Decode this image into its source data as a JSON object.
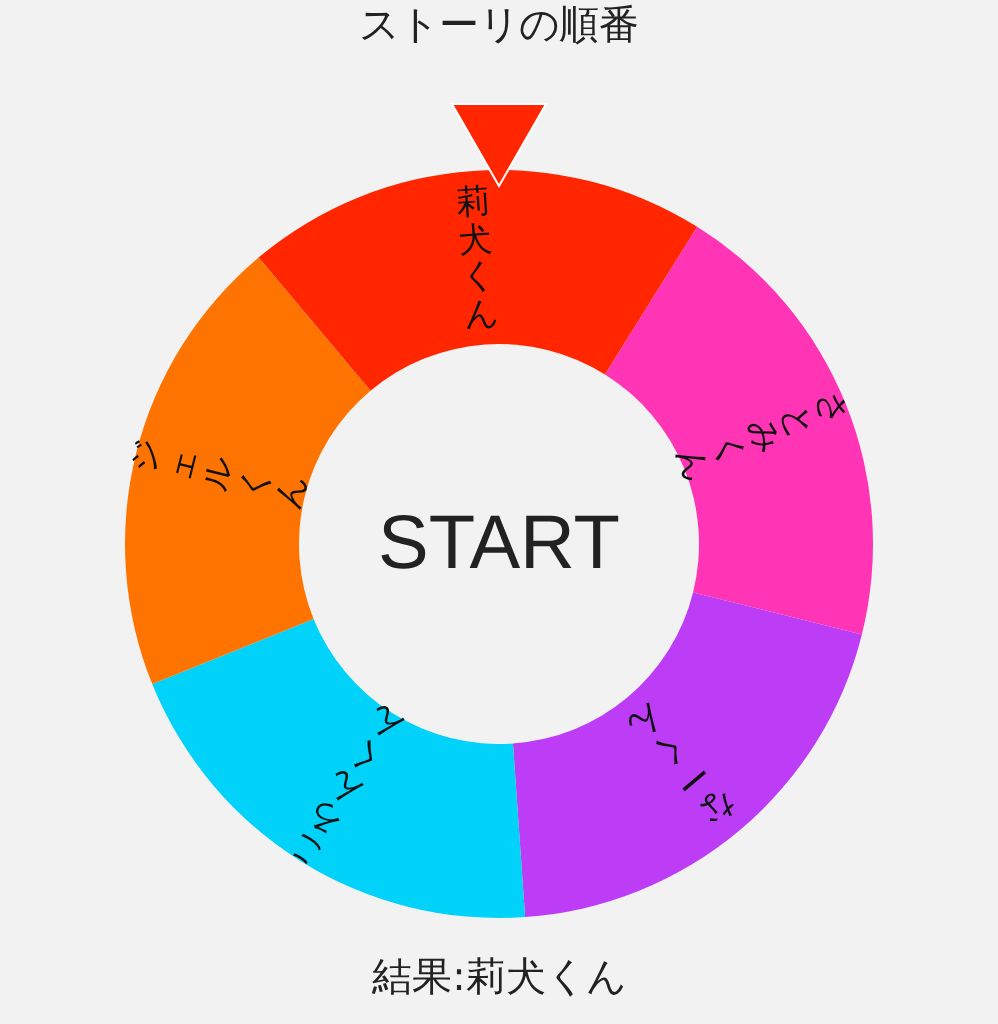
{
  "title": "ストーリの順番",
  "wheel": {
    "center_label": "START",
    "segments": [
      {
        "label": "莉犬くん",
        "color": "#ff2600"
      },
      {
        "label": "さとみくん",
        "color": "#ff35b5"
      },
      {
        "label": "なーくん",
        "color": "#bd3df7"
      },
      {
        "label": "ころんくん",
        "color": "#00d2fa"
      },
      {
        "label": "ジェルくん",
        "color": "#ff7400"
      }
    ]
  },
  "result": "結果:莉犬くん"
}
